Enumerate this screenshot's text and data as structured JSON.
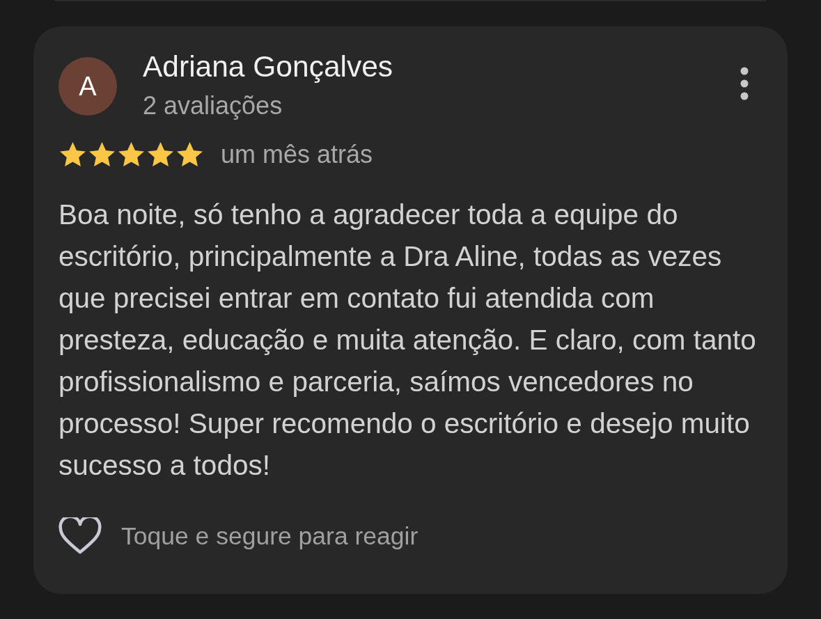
{
  "review": {
    "avatar_letter": "A",
    "author": "Adriana Gonçalves",
    "meta": "2 avaliações",
    "stars": 5,
    "date": "um mês atrás",
    "text": "Boa noite, só tenho a agradecer toda a equipe do escritório, principalmente a Dra Aline, todas as vezes que precisei entrar em contato fui atendida com presteza, educação e muita atenção. E claro, com tanto profissionalismo e parceria, saímos vencedores no processo! Super recomendo o escritório e desejo muito sucesso a todos!",
    "reaction_hint": "Toque e segure para reagir"
  }
}
